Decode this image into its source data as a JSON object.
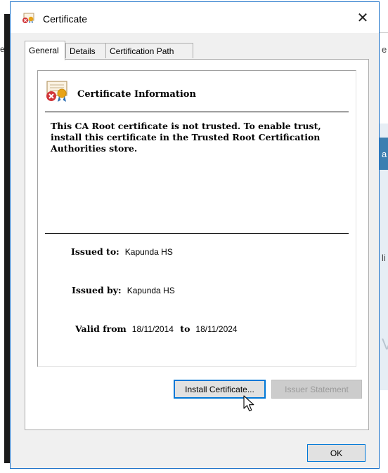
{
  "dialog": {
    "title": "Certificate",
    "close_glyph": "✕"
  },
  "tabs": [
    {
      "label": "General",
      "active": true
    },
    {
      "label": "Details",
      "active": false
    },
    {
      "label": "Certification Path",
      "active": false
    }
  ],
  "info": {
    "title": "Certificate Information",
    "message": "This CA Root certificate is not trusted. To enable trust, install this certificate in the Trusted Root Certification Authorities store.",
    "issued_to_label": "Issued to:",
    "issued_to_value": "Kapunda HS",
    "issued_by_label": "Issued by:",
    "issued_by_value": "Kapunda HS",
    "valid_from_label": "Valid from",
    "valid_from_value": "18/11/2014",
    "valid_to_label": "to",
    "valid_to_value": "18/11/2024"
  },
  "buttons": {
    "install": "Install Certificate...",
    "issuer_statement": "Issuer Statement",
    "ok": "OK"
  },
  "background": {
    "left_fragment": "e",
    "right_fragments": [
      "e",
      "a",
      "li",
      "V"
    ]
  },
  "icons": {
    "title": "certificate-error-icon",
    "info": "certificate-error-large-icon",
    "cursor": "mouse-pointer-icon"
  },
  "colors": {
    "accent": "#0078d7",
    "window_border": "#1e73c9",
    "error_red": "#d13438"
  }
}
